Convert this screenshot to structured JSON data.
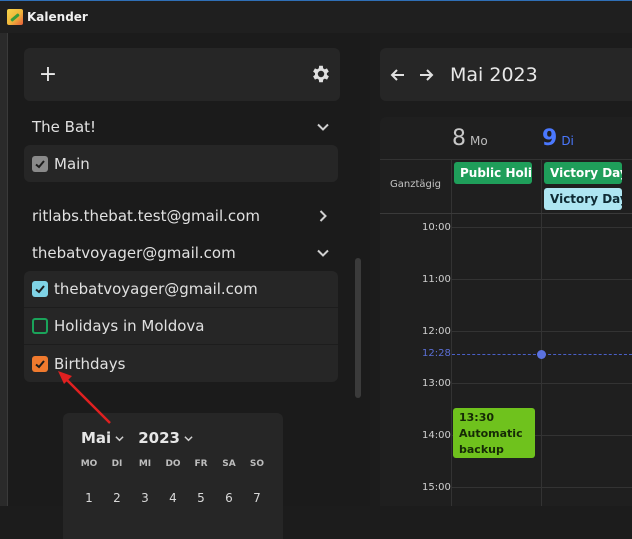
{
  "window": {
    "title": "Kalender"
  },
  "sidebar": {
    "add_label": "+",
    "accounts": [
      {
        "name": "The Bat!",
        "expanded": true,
        "calendars": [
          {
            "label": "Main",
            "checked": true,
            "color": "#8a8a8a"
          }
        ]
      },
      {
        "name": "ritlabs.thebat.test@gmail.com",
        "expanded": false,
        "calendars": []
      },
      {
        "name": "thebatvoyager@gmail.com",
        "expanded": true,
        "calendars": [
          {
            "label": "thebatvoyager@gmail.com",
            "checked": true,
            "color": "#7fd3e6"
          },
          {
            "label": "Holidays in Moldova",
            "checked": false,
            "color": "#1aa35a"
          },
          {
            "label": "Birthdays",
            "checked": true,
            "color": "#f07a2e"
          }
        ]
      }
    ],
    "mini_calendar": {
      "month": "Mai",
      "year": "2023",
      "weekdays": [
        "MO",
        "DI",
        "MI",
        "DO",
        "FR",
        "SA",
        "SO"
      ],
      "days": [
        "1",
        "2",
        "3",
        "4",
        "5",
        "6",
        "7"
      ]
    }
  },
  "main": {
    "month_title": "Mai 2023",
    "days": [
      {
        "num": "8",
        "name": "Mo",
        "today": false
      },
      {
        "num": "9",
        "name": "Di",
        "today": true
      }
    ],
    "allday_label": "Ganztägig",
    "allday_events": [
      {
        "title": "Public Holi…",
        "color": "#1f9e5a",
        "text_color": "#ffffff"
      },
      {
        "title": "Victory Day",
        "color": "#1f9e5a",
        "text_color": "#ffffff"
      },
      {
        "title": "Victory Day",
        "color": "#aee6f2",
        "text_color": "#0e2a33"
      }
    ],
    "hours": [
      "10:00",
      "11:00",
      "12:00",
      "13:00",
      "14:00",
      "15:00"
    ],
    "now_label": "12:28",
    "event": {
      "time": "13:30",
      "line1": "Automatic",
      "line2": "backup",
      "color": "#6fc21d"
    }
  }
}
